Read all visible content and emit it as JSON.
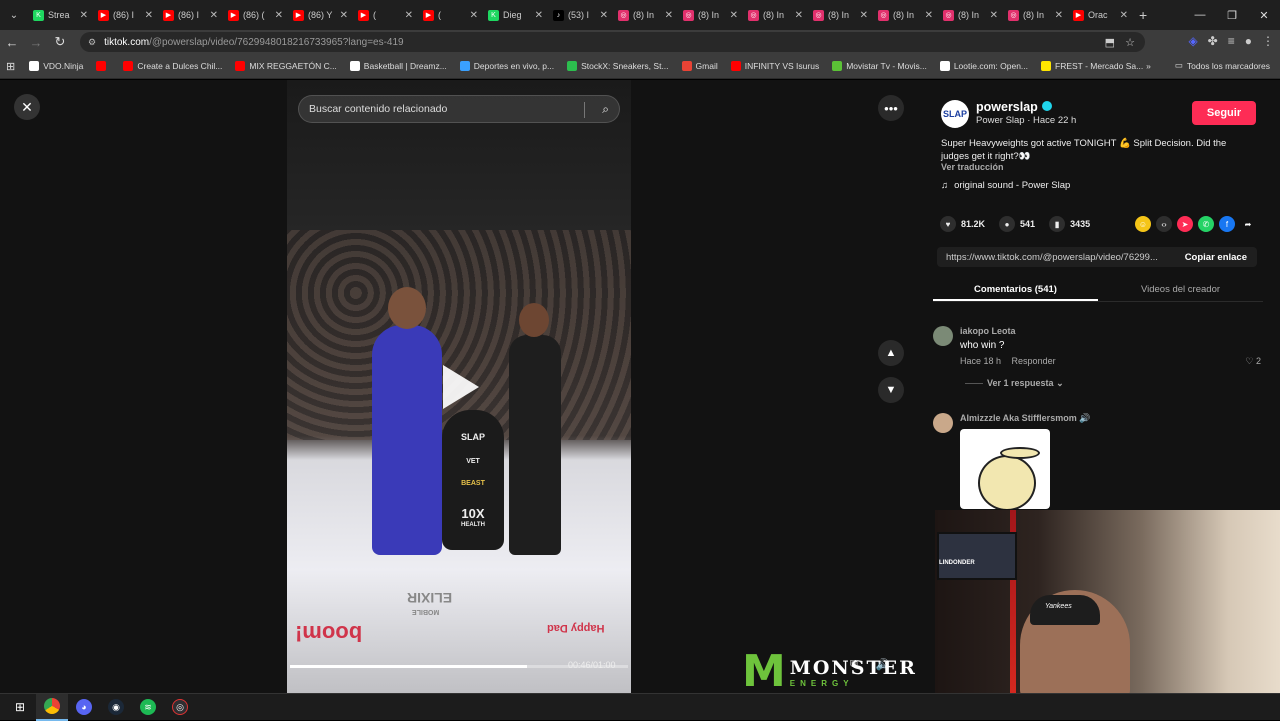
{
  "browser": {
    "tabs": [
      {
        "label": "Strea",
        "color": "#1ed760",
        "icon": "kick-icon",
        "glyph": "K"
      },
      {
        "label": "(86) I",
        "color": "#ff0000",
        "icon": "youtube-icon",
        "glyph": "▶"
      },
      {
        "label": "(86) I",
        "color": "#ff0000",
        "icon": "youtube-icon",
        "glyph": "▶"
      },
      {
        "label": "(86) (",
        "color": "#ff0000",
        "icon": "youtube-icon",
        "glyph": "▶"
      },
      {
        "label": "(86) Y",
        "color": "#ff0000",
        "icon": "youtube-icon",
        "glyph": "▶"
      },
      {
        "label": "(",
        "color": "#ff0000",
        "icon": "youtube-icon",
        "glyph": "▶"
      },
      {
        "label": "(",
        "color": "#ff0000",
        "icon": "youtube-icon",
        "glyph": "▶"
      },
      {
        "label": "Dieg",
        "color": "#1ed760",
        "icon": "kick-icon",
        "glyph": "K"
      },
      {
        "label": "(53) I",
        "color": "#000000",
        "icon": "tiktok-icon",
        "glyph": "♪"
      },
      {
        "label": "(8) In",
        "color": "#e1306c",
        "icon": "instagram-icon",
        "glyph": "◎"
      },
      {
        "label": "(8) In",
        "color": "#e1306c",
        "icon": "instagram-icon",
        "glyph": "◎"
      },
      {
        "label": "(8) In",
        "color": "#e1306c",
        "icon": "instagram-icon",
        "glyph": "◎"
      },
      {
        "label": "(8) In",
        "color": "#e1306c",
        "icon": "instagram-icon",
        "glyph": "◎"
      },
      {
        "label": "(8) In",
        "color": "#e1306c",
        "icon": "instagram-icon",
        "glyph": "◎"
      },
      {
        "label": "(8) In",
        "color": "#e1306c",
        "icon": "instagram-icon",
        "glyph": "◎"
      },
      {
        "label": "(8) In",
        "color": "#e1306c",
        "icon": "instagram-icon",
        "glyph": "◎"
      },
      {
        "label": "Orac",
        "color": "#ff0000",
        "icon": "youtube-icon",
        "glyph": "▶"
      }
    ],
    "url_host": "tiktok.com",
    "url_path": "/@powerslap/video/7629948018216733965?lang=es-419",
    "bookmarks": [
      {
        "label": "VDO.Ninja",
        "color": "#ffffff"
      },
      {
        "label": "",
        "color": "#ff0000"
      },
      {
        "label": "Create a Dulces Chil...",
        "color": "#ff0000"
      },
      {
        "label": "MIX REGGAETÓN C...",
        "color": "#ff0000"
      },
      {
        "label": "Basketball | Dreamz...",
        "color": "#ffffff"
      },
      {
        "label": "Deportes en vivo, p...",
        "color": "#3aa0ff"
      },
      {
        "label": "StockX: Sneakers, St...",
        "color": "#2cbe4e"
      },
      {
        "label": "Gmail",
        "color": "#ea4335"
      },
      {
        "label": "INFINITY VS Isurus",
        "color": "#ff0000"
      },
      {
        "label": "Movistar Tv - Movis...",
        "color": "#5bc236"
      },
      {
        "label": "Lootie.com: Open...",
        "color": "#ffffff"
      },
      {
        "label": "FREST - Mercado Sa...",
        "color": "#ffe600"
      }
    ],
    "all_bookmarks": "Todos los marcadores"
  },
  "video": {
    "search_placeholder": "Buscar contenido relacionado",
    "time": "00:46/01:00",
    "progress": 0.7,
    "podium_brand": "SLAP",
    "podium_vet": "VET",
    "podium_beast": "BEAST",
    "podium_10x": "10X",
    "podium_health": "HEALTH",
    "ring_boom": "boom!",
    "ring_elixir": "ELIXIR",
    "ring_mobile": "MOBILE",
    "ring_happy": "Happy Dad"
  },
  "post": {
    "avatar_text": "SLAP",
    "username": "powerslap",
    "subtitle": "Power Slap · Hace 22 h",
    "follow": "Seguir",
    "description": "Super Heavyweights got active TONIGHT 💪 Split Decision. Did the judges get it right?👀",
    "translate": "Ver traducción",
    "sound": "original sound - Power Slap",
    "likes": "81.2K",
    "comments": "541",
    "saves": "3435",
    "link": "https://www.tiktok.com/@powerslap/video/76299...",
    "copy_link": "Copiar enlace",
    "tab_comments": "Comentarios (541)",
    "tab_videos": "Videos del creador"
  },
  "comments": [
    {
      "name": "iakopo Leota",
      "text": "who win ?",
      "time": "Hace 18 h",
      "reply": "Responder",
      "likes": "2",
      "replies": "Ver 1 respuesta"
    },
    {
      "name": "Almizzzle Aka Stifflersmom 🔊"
    }
  ],
  "webcam": {
    "tv_text": "LINDONDER",
    "cap_text": "Yankees"
  },
  "overlay": {
    "monster_claw": "M",
    "monster_title": "MONSTER",
    "monster_sub": "ENERGY"
  }
}
